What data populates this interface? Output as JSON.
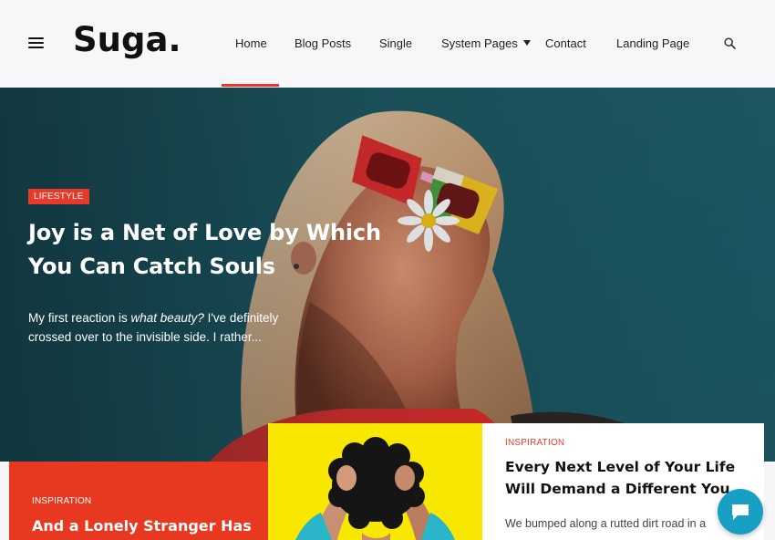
{
  "brand": {
    "logo": "Suga."
  },
  "nav": {
    "items": [
      {
        "label": "Home",
        "active": true
      },
      {
        "label": "Blog Posts"
      },
      {
        "label": "Single"
      },
      {
        "label": "System Pages",
        "dropdown": true
      },
      {
        "label": "Contact"
      },
      {
        "label": "Landing Page"
      }
    ],
    "menu_icon": "hamburger-menu-icon",
    "search_icon": "search-icon"
  },
  "hero": {
    "category": "LIFESTYLE",
    "title": "Joy is a Net of Love by Which You Can Catch Souls",
    "excerpt_before": "My first reaction is ",
    "excerpt_emphasis": "what beauty?",
    "excerpt_after": " I've definitely crossed over to the invisible side. I rather..."
  },
  "cards": [
    {
      "category": "INSPIRATION",
      "title": "And a Lonely Stranger Has"
    },
    {
      "category": "INSPIRATION",
      "title": "Every Next Level of Your Life Will Demand a Different You",
      "excerpt": "We bumped along a rutted dirt road in a"
    }
  ],
  "colors": {
    "accent": "#e8392b",
    "hero_bg": "#1b5560",
    "card_red": "#e8381f",
    "card_yellow": "#f8e700",
    "chat": "#18a0c4"
  },
  "chat": {
    "icon": "chat-bubble-icon"
  }
}
